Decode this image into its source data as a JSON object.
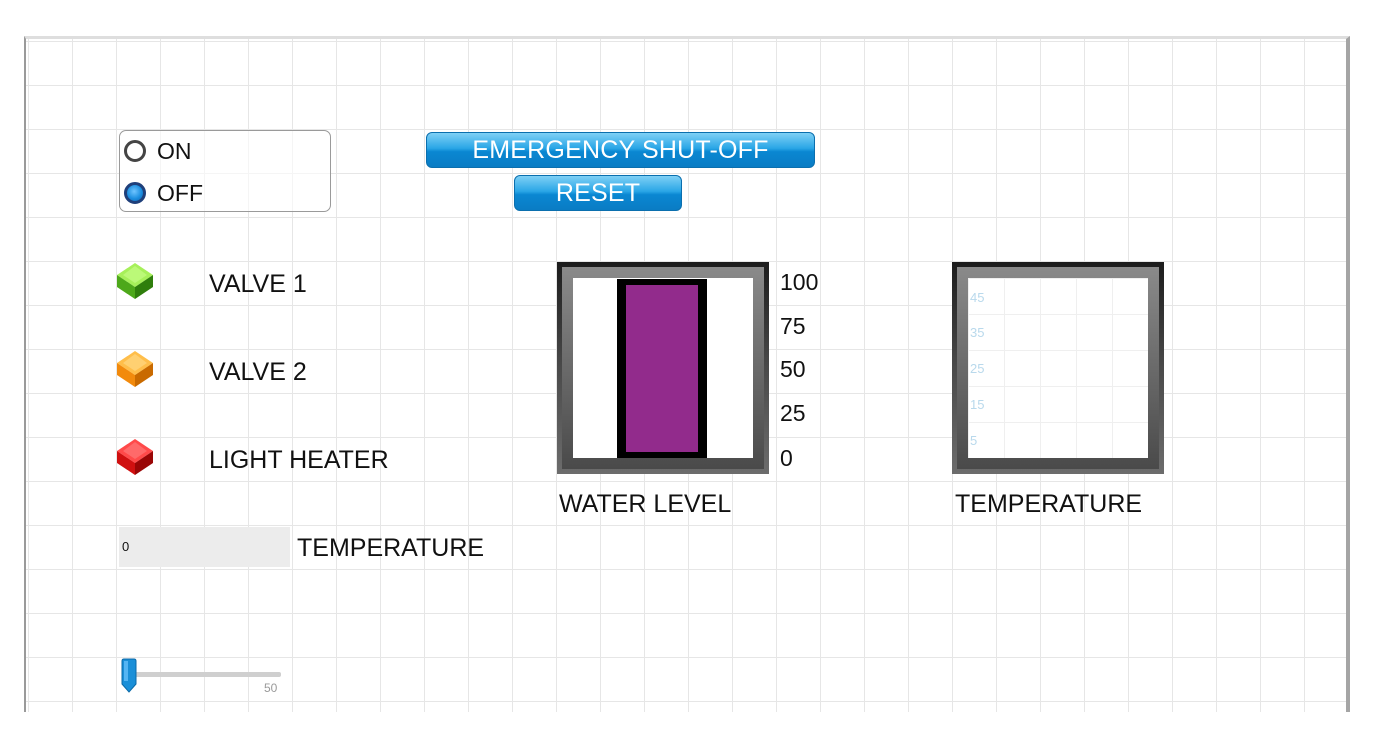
{
  "power_switch": {
    "options": [
      {
        "label": "ON",
        "selected": false
      },
      {
        "label": "OFF",
        "selected": true
      }
    ]
  },
  "buttons": {
    "emergency": "EMERGENCY SHUT-OFF",
    "reset": "RESET"
  },
  "indicators": [
    {
      "label": "VALVE 1",
      "color": "#5cc81e"
    },
    {
      "label": "VALVE 2",
      "color": "#ff9612"
    },
    {
      "label": "LIGHT HEATER",
      "color": "#e01616"
    }
  ],
  "temperature_readout": {
    "value": "0",
    "label": "TEMPERATURE"
  },
  "slider": {
    "value": 0,
    "max_label": "50"
  },
  "water_level": {
    "label": "WATER LEVEL",
    "scale": [
      "100",
      "75",
      "50",
      "25",
      "0"
    ],
    "fill_color": "#922b8c",
    "fill_fraction": 1.0
  },
  "temperature_chart": {
    "label": "TEMPERATURE",
    "ticks": [
      "45",
      "35",
      "25",
      "15",
      "5"
    ]
  }
}
